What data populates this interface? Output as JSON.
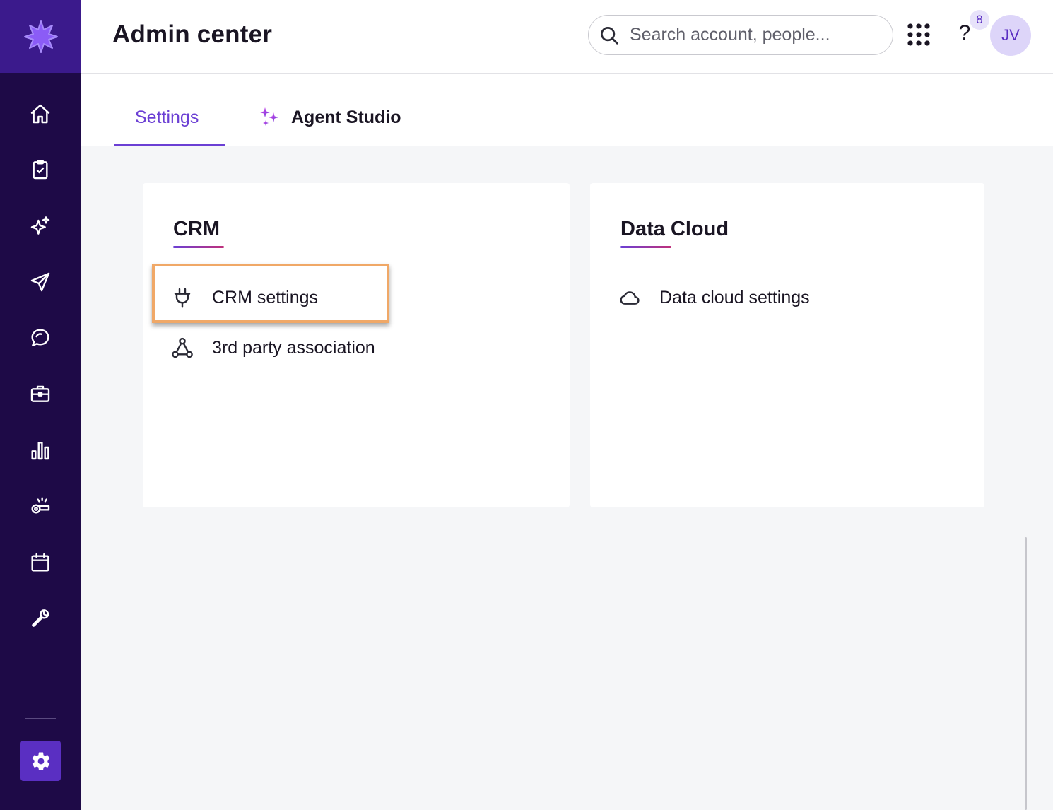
{
  "header": {
    "title": "Admin center",
    "search_placeholder": "Search account, people...",
    "help_label": "?",
    "notification_count": "8",
    "avatar_initials": "JV"
  },
  "tabs": [
    {
      "label": "Settings",
      "active": true
    },
    {
      "label": "Agent Studio",
      "active": false
    }
  ],
  "cards": {
    "crm": {
      "title": "CRM",
      "items": [
        {
          "label": "CRM settings",
          "icon": "plug-icon",
          "highlighted": true
        },
        {
          "label": "3rd party association",
          "icon": "network-icon"
        }
      ]
    },
    "data_cloud": {
      "title": "Data Cloud",
      "items": [
        {
          "label": "Data cloud settings",
          "icon": "cloud-icon"
        }
      ]
    }
  },
  "sidebar": {
    "items": [
      {
        "icon": "home-icon"
      },
      {
        "icon": "clipboard-check-icon"
      },
      {
        "icon": "sparkles-icon"
      },
      {
        "icon": "send-icon"
      },
      {
        "icon": "chat-icon"
      },
      {
        "icon": "briefcase-icon"
      },
      {
        "icon": "bar-chart-icon"
      },
      {
        "icon": "whistle-icon"
      },
      {
        "icon": "calendar-icon"
      },
      {
        "icon": "wrench-icon"
      }
    ],
    "active_bottom": "gear-icon"
  },
  "colors": {
    "sidebar_bg": "#1e0a47",
    "logo_bg": "#3b1a8c",
    "accent": "#6b3fd4",
    "highlight_border": "#f0a867"
  }
}
